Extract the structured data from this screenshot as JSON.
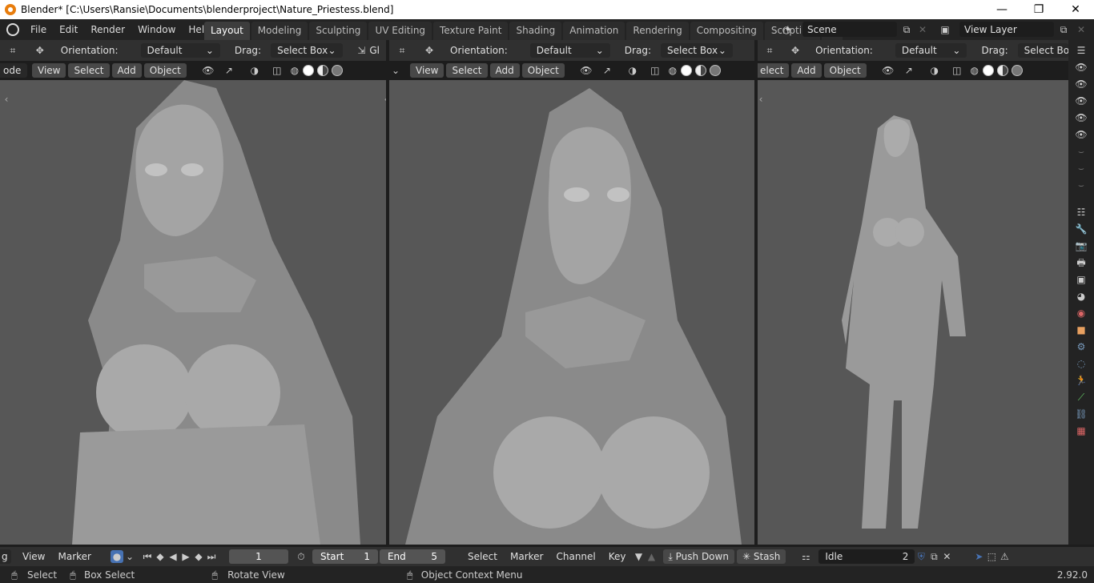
{
  "window": {
    "title": "Blender* [C:\\Users\\Ransie\\Documents\\blenderproject\\Nature_Priestess.blend]",
    "minimize": "—",
    "maximize": "❐",
    "close": "✕"
  },
  "menu": [
    "File",
    "Edit",
    "Render",
    "Window",
    "Help"
  ],
  "workspaces": [
    "Layout",
    "Modeling",
    "Sculpting",
    "UV Editing",
    "Texture Paint",
    "Shading",
    "Animation",
    "Rendering",
    "Compositing",
    "Scripting"
  ],
  "add_tab": "+",
  "scene": {
    "name": "Scene",
    "view_layer": "View Layer"
  },
  "viewport": {
    "orientation_label": "Orientation:",
    "orientation_value": "Default",
    "drag_label": "Drag:",
    "drag_value": "Select Box",
    "drag_value_short": "Select Bo",
    "global_short": "Gl",
    "mode_left": "ode",
    "menu": [
      "View",
      "Select",
      "Add",
      "Object"
    ],
    "select_short": "elect"
  },
  "timeline": {
    "mode_cut": "g",
    "view": "View",
    "marker": "Marker",
    "current_frame": "1",
    "start_label": "Start",
    "start": "1",
    "end_label": "End",
    "end": "5",
    "nla_select": "Select",
    "nla_marker": "Marker",
    "nla_channel": "Channel",
    "nla_key": "Key",
    "push_down": "Push Down",
    "stash": "Stash",
    "action": "Idle",
    "users": "2"
  },
  "status": {
    "select": "Select",
    "box_select": "Box Select",
    "rotate": "Rotate View",
    "context": "Object Context Menu",
    "version": "2.92.0"
  }
}
